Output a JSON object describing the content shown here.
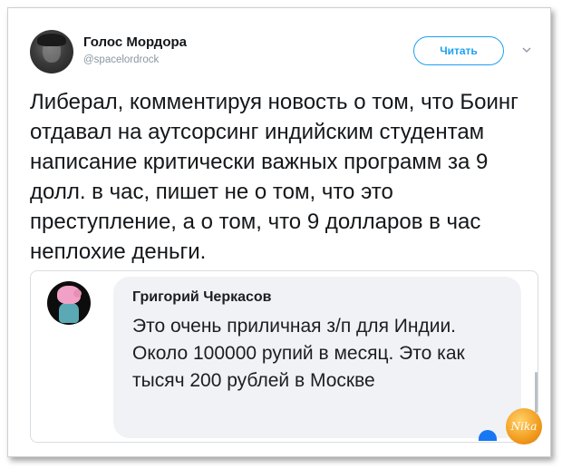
{
  "tweet": {
    "display_name": "Голос Мордора",
    "handle": "@spacelordrock",
    "follow_label": "Читать",
    "text": "Либерал, комментируя новость о том, что Боинг отдавал на аутсорсинг индийским студентам написание критически важных программ за 9 долл. в час, пишет не о том, что это преступление, а о том, что 9 долларов в час неплохие деньги."
  },
  "quoted_comment": {
    "author": "Григорий Черкасов",
    "text": "Это очень приличная з/п для Индии. Около 100000 рупий в месяц. Это как тысяч 200 рублей в Москве"
  },
  "watermark": {
    "text": "Nika"
  },
  "icons": {
    "avatar": "user-avatar-icon",
    "menu": "chevron-down-icon",
    "quoted_avatar": "pig-avatar-icon",
    "reaction": "like-reaction-icon"
  },
  "colors": {
    "accent": "#1da1f2",
    "text": "#14171a",
    "muted": "#8a96a3",
    "bubble": "#f0f2f5"
  }
}
